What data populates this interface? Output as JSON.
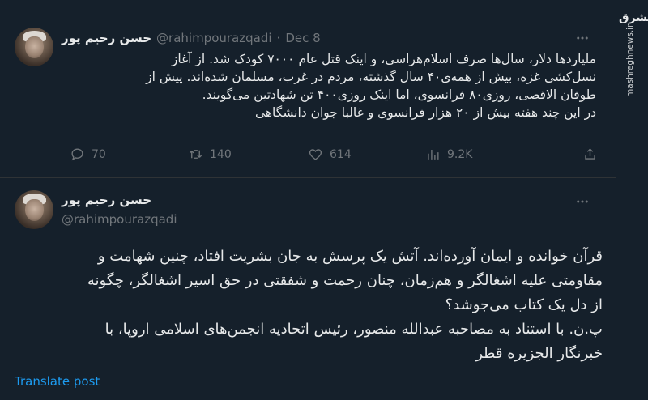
{
  "tweet1": {
    "display_name": "حسن رحیم پور",
    "handle": "@rahimpourazqadi",
    "separator": "·",
    "date": "Dec 8",
    "lines": [
      "ملیاردها دلار، سال‌ها صرف اسلام‌هراسی،  و اینک قتل عام ۷۰۰۰ کودک شد. از آغاز",
      "نسل‌کشی غزه، بیش از همه‌ی۴۰ سال گذشته، مردم در غرب، مسلمان شده‌اند. پیش از",
      "طوفان الاقصی، روزی۸۰ فرانسوی، اما اینک روزی۴۰۰ تن شهادتین می‌گویند.",
      "در این چند هفته بیش از ۲۰ هزار فرانسوی و غالبا جوان دانشگاهی"
    ],
    "actions": {
      "replies": "70",
      "retweets": "140",
      "likes": "614",
      "views": "9.2K"
    }
  },
  "tweet2": {
    "display_name": "حسن رحیم پور",
    "handle": "@rahimpourazqadi",
    "lines": [
      "قرآن خوانده و ایمان آورده‌اند. آتش یک پرسش به جان بشریت افتاد، چنین شهامت و",
      "مقاومتی علیه اشغالگر و هم‌زمان، چنان رحمت و شفقتی در حق اسیر اشغالگر، چگونه",
      "از دل یک کتاب می‌جوشد؟",
      "پ.ن. با استناد به مصاحبه عبدالله منصور، رئیس اتحادیه انجمن‌های اسلامی اروپا، با",
      "خبرنگار الجزیره قطر"
    ],
    "translate_label": "Translate post"
  },
  "watermark": {
    "logo_text": "مشرق",
    "url_text": "mashreghnews.ir"
  },
  "colors": {
    "background": "#15202b",
    "text": "#e7e9ea",
    "muted": "#71767b",
    "link": "#1d9bf0",
    "divider": "#2f3336"
  }
}
